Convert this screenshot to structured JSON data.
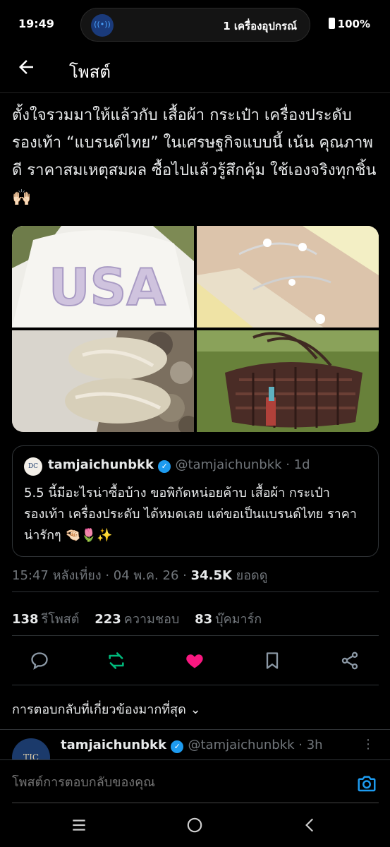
{
  "status": {
    "time": "19:49",
    "device_count": "1 เครื่องอุปกรณ์",
    "battery": "100%",
    "pill_icon_badge": "1"
  },
  "header": {
    "title": "โพสต์"
  },
  "post": {
    "text": "ตั้งใจรวมมาให้แล้วกับ เสื้อผ้า กระเป๋า เครื่องประดับ รองเท้า “แบรนด์ไทย” ในเศรษฐกิจแบบนี้ เน้น คุณภาพดี ราคาสมเหตุสมผล ซื้อไปแล้วรู้สึกคุ้ม ใช้เองจริงทุกชิ้น 🙌🏻",
    "images": [
      "white-tshirt-usa",
      "silver-bracelets",
      "mesh-mary-jane-shoes",
      "woven-brown-bag"
    ],
    "image_text": {
      "usa": "USA"
    }
  },
  "quote": {
    "avatar_text": "DC",
    "name": "tamjaichunbkk",
    "handle": "@tamjaichunbkk · 1d",
    "text": "5.5 นี้มีอะไรน่าซื้อบ้าง ขอพิกัดหน่อยค้าบ เสื้อผ้า กระเป๋า รองเท้า เครื่องประดับ ได้หมดเลย แต่ขอเป็นแบรนด์ไทย ราคาน่ารักๆ 🤏🏻🌷✨"
  },
  "meta": {
    "time": "15:47 หลังเที่ยง · 04 พ.ค. 26 · ",
    "views_count": "34.5K",
    "views_label": " ยอดดู"
  },
  "stats": {
    "reposts": "138",
    "reposts_label": "รีโพสต์",
    "likes": "223",
    "likes_label": "ความชอบ",
    "bookmarks": "83",
    "bookmarks_label": "บุ๊คมาร์ก"
  },
  "actions": {
    "reply_icon": "reply-icon",
    "repost_icon": "repost-icon",
    "like_icon": "heart-icon",
    "bookmark_icon": "bookmark-icon",
    "share_icon": "share-icon"
  },
  "colors": {
    "repost": "#00ba7c",
    "like": "#f91880",
    "accent": "#1d9bf0"
  },
  "replies": {
    "sort_label": "การตอบกลับที่เกี่ยวข้องมากที่สุด ⌄"
  },
  "reply": {
    "avatar_text": "TJC",
    "name": "tamjaichunbkk",
    "handle": "@tamjaichunbkk · 3h",
    "more": "⋮"
  },
  "composer": {
    "placeholder": "โพสต์การตอบกลับของคุณ"
  }
}
